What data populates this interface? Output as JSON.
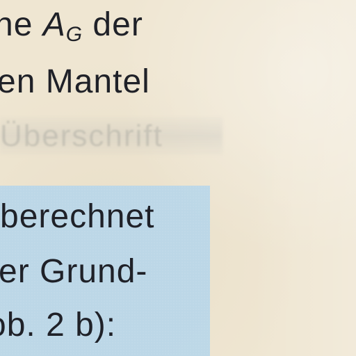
{
  "document": {
    "lines": [
      {
        "before": "ne ",
        "symbol_main": "A",
        "symbol_sub": "G",
        "after": " der"
      },
      {
        "text": "en  Mantel"
      },
      {
        "text": "berechnet"
      },
      {
        "text": "er  Grund-"
      },
      {
        "text": "ob. 2 b):"
      }
    ],
    "faded_text": "Überschrift"
  },
  "colors": {
    "paper": "#efe6d2",
    "highlight": "#b9d7ea",
    "text": "#1f2128"
  }
}
